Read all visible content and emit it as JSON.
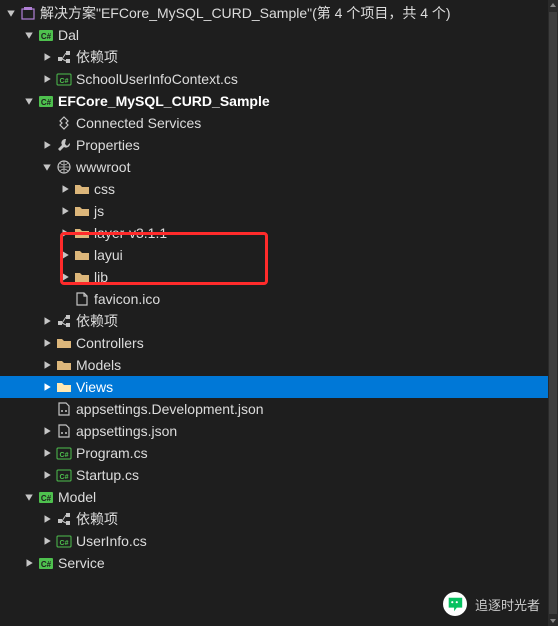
{
  "solution": {
    "label": "解决方案\"EFCore_MySQL_CURD_Sample\"(第 4 个项目，共 4 个)"
  },
  "projects": {
    "dal": {
      "name": "Dal",
      "deps": "依赖项",
      "file1": "SchoolUserInfoContext.cs"
    },
    "sample": {
      "name": "EFCore_MySQL_CURD_Sample",
      "connected": "Connected Services",
      "properties": "Properties",
      "wwwroot": "wwwroot",
      "css": "css",
      "js": "js",
      "layer": "layer-v3.1.1",
      "layui": "layui",
      "lib": "lib",
      "favicon": "favicon.ico",
      "deps": "依赖项",
      "controllers": "Controllers",
      "models": "Models",
      "views": "Views",
      "appsettings_dev": "appsettings.Development.json",
      "appsettings": "appsettings.json",
      "program": "Program.cs",
      "startup": "Startup.cs"
    },
    "model": {
      "name": "Model",
      "deps": "依赖项",
      "file1": "UserInfo.cs"
    },
    "service": {
      "name": "Service"
    }
  },
  "watermark": "追逐时光者"
}
